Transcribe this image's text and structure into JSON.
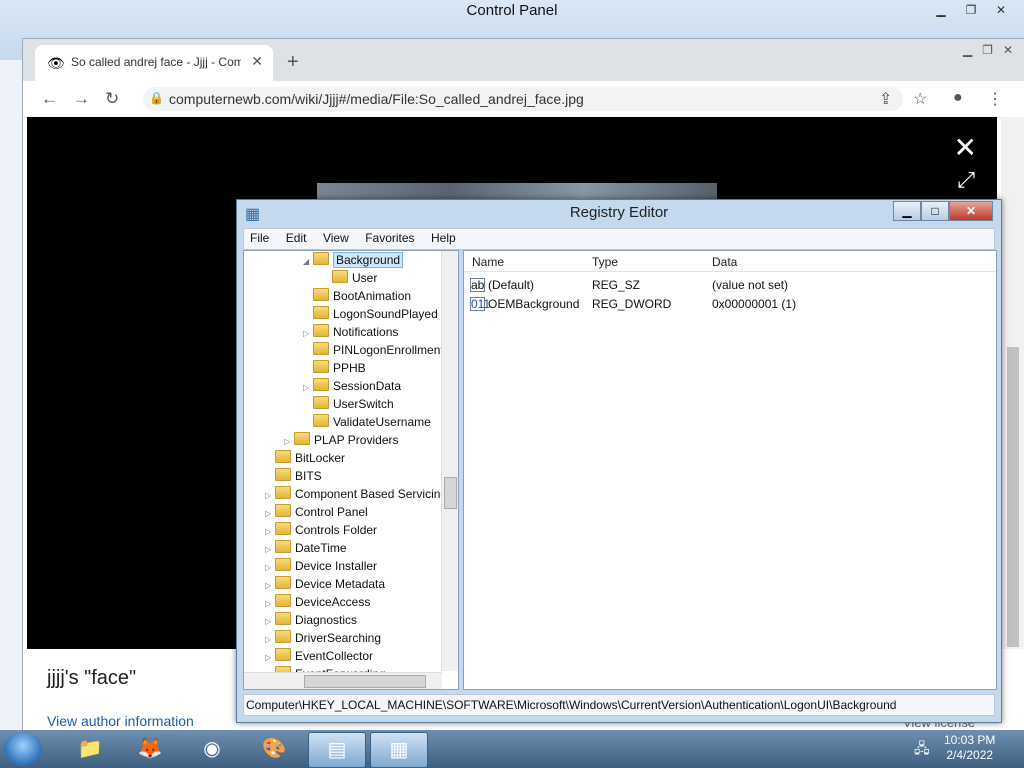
{
  "control_panel": {
    "title": "Control Panel"
  },
  "browser": {
    "tab_title": "So called andrej face - Jjjj - Comp",
    "url": "computernewb.com/wiki/Jjjj#/media/File:So_called_andrej_face.jpg",
    "caption": "jjjj's \"face\"",
    "author_link": "View author information",
    "license_link": "View license"
  },
  "registry": {
    "title": "Registry Editor",
    "menu": [
      "File",
      "Edit",
      "View",
      "Favorites",
      "Help"
    ],
    "tree": [
      {
        "label": "Background",
        "indent": 3,
        "expanded": true,
        "selected": true
      },
      {
        "label": "User",
        "indent": 4
      },
      {
        "label": "BootAnimation",
        "indent": 3
      },
      {
        "label": "LogonSoundPlayed",
        "indent": 3
      },
      {
        "label": "Notifications",
        "indent": 3,
        "collapsed": true
      },
      {
        "label": "PINLogonEnrollment",
        "indent": 3
      },
      {
        "label": "PPHB",
        "indent": 3
      },
      {
        "label": "SessionData",
        "indent": 3,
        "collapsed": true
      },
      {
        "label": "UserSwitch",
        "indent": 3
      },
      {
        "label": "ValidateUsername",
        "indent": 3
      },
      {
        "label": "PLAP Providers",
        "indent": 2,
        "collapsed": true
      },
      {
        "label": "BitLocker",
        "indent": 1
      },
      {
        "label": "BITS",
        "indent": 1
      },
      {
        "label": "Component Based Servicing",
        "indent": 1,
        "collapsed": true
      },
      {
        "label": "Control Panel",
        "indent": 1,
        "collapsed": true
      },
      {
        "label": "Controls Folder",
        "indent": 1,
        "collapsed": true
      },
      {
        "label": "DateTime",
        "indent": 1,
        "collapsed": true
      },
      {
        "label": "Device Installer",
        "indent": 1,
        "collapsed": true
      },
      {
        "label": "Device Metadata",
        "indent": 1,
        "collapsed": true
      },
      {
        "label": "DeviceAccess",
        "indent": 1,
        "collapsed": true
      },
      {
        "label": "Diagnostics",
        "indent": 1,
        "collapsed": true
      },
      {
        "label": "DriverSearching",
        "indent": 1,
        "collapsed": true
      },
      {
        "label": "EventCollector",
        "indent": 1,
        "collapsed": true
      },
      {
        "label": "EventForwarding",
        "indent": 1,
        "collapsed": true
      }
    ],
    "columns": {
      "name": "Name",
      "type": "Type",
      "data": "Data"
    },
    "values": [
      {
        "icon": "string-value-icon",
        "badge": "ab",
        "name": "(Default)",
        "type": "REG_SZ",
        "data": "(value not set)"
      },
      {
        "icon": "dword-value-icon",
        "badge": "011",
        "name": "OEMBackground",
        "type": "REG_DWORD",
        "data": "0x00000001 (1)"
      }
    ],
    "status_path": "Computer\\HKEY_LOCAL_MACHINE\\SOFTWARE\\Microsoft\\Windows\\CurrentVersion\\Authentication\\LogonUI\\Background"
  },
  "taskbar": {
    "time": "10:03 PM",
    "date": "2/4/2022"
  }
}
